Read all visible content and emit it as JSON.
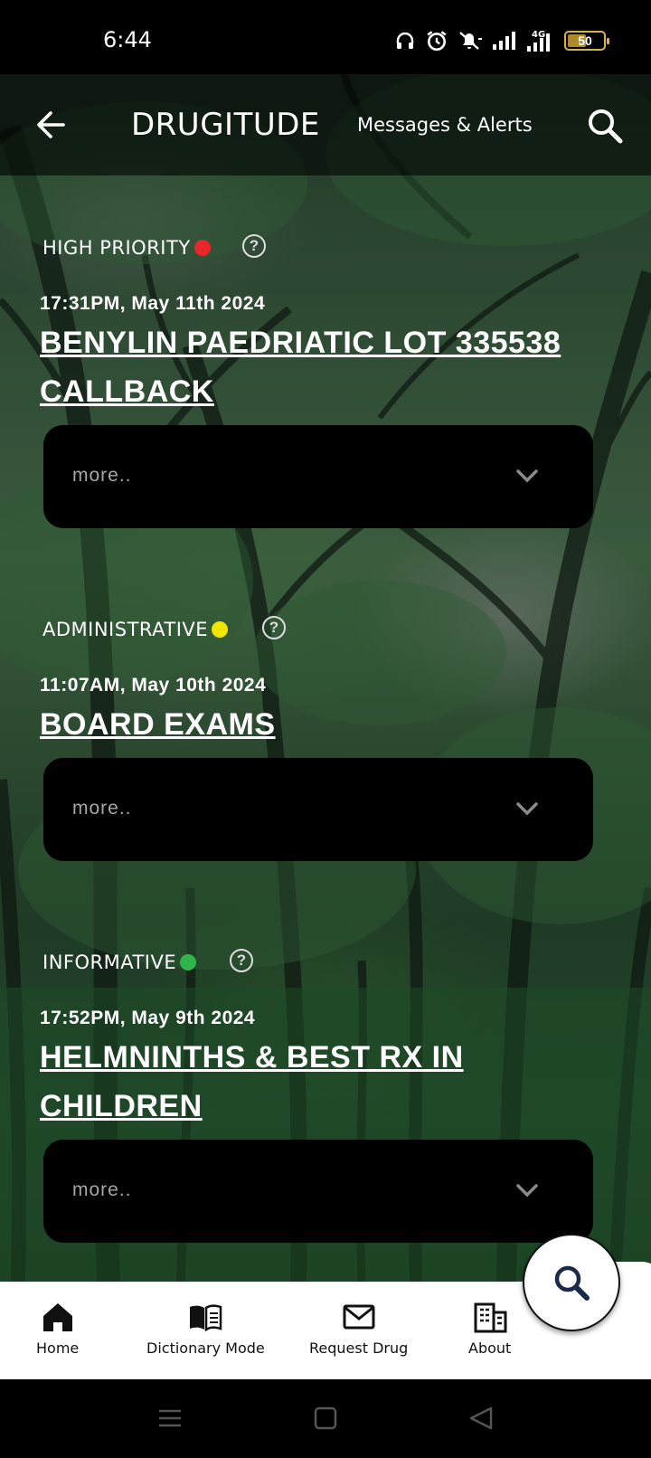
{
  "status_bar": {
    "time": "6:44",
    "battery": "50"
  },
  "app_bar": {
    "title": "DRUGITUDE",
    "subtitle": "Messages & Alerts"
  },
  "messages": [
    {
      "category": "HIGH PRIORITY",
      "dot_color": "#e8262c",
      "timestamp": "17:31PM, May 11th 2024",
      "title": "BENYLIN PAEDRIATIC LOT 335538 CALLBACK",
      "more": "more.."
    },
    {
      "category": "ADMINISTRATIVE",
      "dot_color": "#f2e600",
      "timestamp": "11:07AM, May 10th 2024",
      "title": "BOARD EXAMS",
      "more": "more.."
    },
    {
      "category": "INFORMATIVE",
      "dot_color": "#2fb54a",
      "timestamp": "17:52PM, May 9th 2024",
      "title": "HELMNINTHS & BEST RX IN CHILDREN",
      "more": "more.."
    }
  ],
  "help_glyph": "?",
  "bottom_nav": [
    {
      "label": "Home",
      "icon": "home-icon"
    },
    {
      "label": "Dictionary Mode",
      "icon": "book-icon"
    },
    {
      "label": "Request Drug",
      "icon": "mail-icon"
    },
    {
      "label": "About",
      "icon": "building-icon"
    }
  ],
  "fab": {
    "icon": "search-icon"
  }
}
